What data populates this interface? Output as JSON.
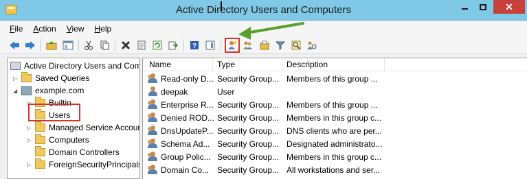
{
  "window": {
    "title": "Active Directory Users and Computers",
    "close_glyph": "✕"
  },
  "menu": [
    "File",
    "Action",
    "View",
    "Help"
  ],
  "toolbar": {
    "icons": [
      "back-icon",
      "forward-icon",
      "up-folder-icon",
      "show-console-tree-icon",
      "cut-icon",
      "copy-icon",
      "delete-icon",
      "properties-icon",
      "refresh-icon",
      "export-list-icon",
      "help-icon",
      "action-pane-icon",
      "new-user-icon",
      "new-group-icon",
      "new-ou-icon",
      "filter-icon",
      "find-icon",
      "add-to-group-icon"
    ],
    "highlighted": "new-user-icon",
    "highlight_color": "#d9342b",
    "arrow_color": "#5aa02c"
  },
  "tree": {
    "root": "Active Directory Users and Com",
    "saved_queries": "Saved Queries",
    "domain": "example.com",
    "items": [
      "Builtin",
      "Users",
      "Managed Service Accour",
      "Computers",
      "Domain Controllers",
      "ForeignSecurityPrincipals"
    ],
    "selected": "Users"
  },
  "list": {
    "columns": [
      "Name",
      "Type",
      "Description"
    ],
    "rows": [
      {
        "name": "Read-only D...",
        "type": "Security Group...",
        "description": "Members of this group ...",
        "icon": "group-icon"
      },
      {
        "name": "deepak",
        "type": "User",
        "description": "",
        "icon": "user-icon"
      },
      {
        "name": "Enterprise R...",
        "type": "Security Group...",
        "description": "Members of this group ...",
        "icon": "group-icon"
      },
      {
        "name": "Denied ROD...",
        "type": "Security Group...",
        "description": "Members in this group c...",
        "icon": "group-icon"
      },
      {
        "name": "DnsUpdateP...",
        "type": "Security Group...",
        "description": "DNS clients who are per...",
        "icon": "group-icon"
      },
      {
        "name": "Schema Ad...",
        "type": "Security Group...",
        "description": "Designated administrato...",
        "icon": "group-icon"
      },
      {
        "name": "Group Polic...",
        "type": "Security Group...",
        "description": "Members in this group c...",
        "icon": "group-icon"
      },
      {
        "name": "Domain Co...",
        "type": "Security Group...",
        "description": "All workstations and ser...",
        "icon": "group-icon"
      }
    ]
  }
}
